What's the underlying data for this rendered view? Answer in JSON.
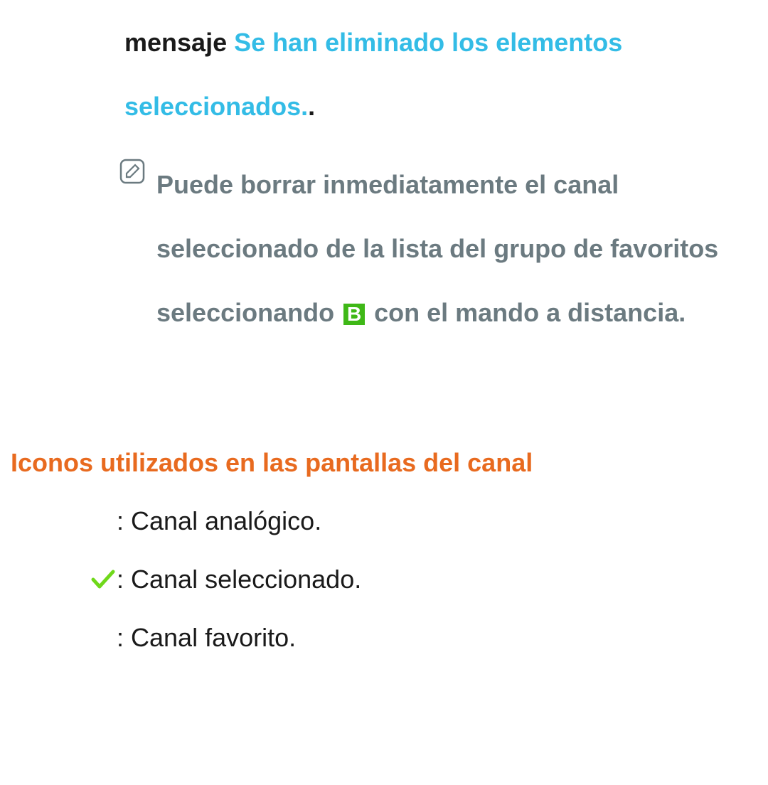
{
  "top": {
    "msg_prefix": "mensaje ",
    "msg_cyan": "Se han eliminado los elementos seleccionados.",
    "msg_period": ".",
    "note_part1": "Puede borrar inmediatamente el canal seleccionado de la lista del grupo de favoritos seleccionando ",
    "note_b": "B",
    "note_part2": " con el mando a distancia."
  },
  "heading": "Iconos utilizados en las pantallas del canal",
  "icons": {
    "item1": ": Canal analógico.",
    "item2": ": Canal seleccionado.",
    "item3": ": Canal favorito."
  }
}
